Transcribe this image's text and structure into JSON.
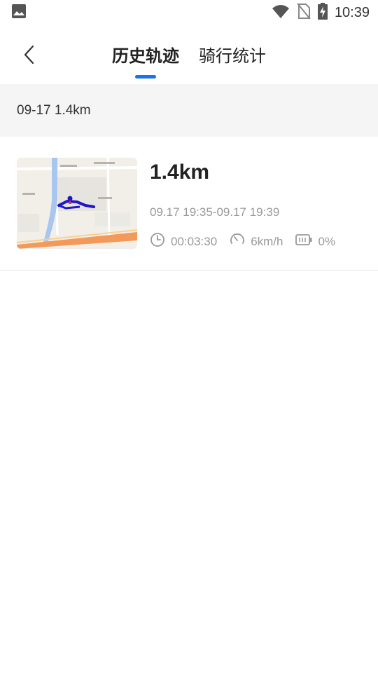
{
  "status_bar": {
    "time": "10:39",
    "icons": [
      "image-icon",
      "wifi-icon",
      "no-sim-icon",
      "battery-charging-icon"
    ]
  },
  "header": {
    "back_icon": "chevron-left-icon",
    "tabs": [
      {
        "label": "历史轨迹",
        "active": true
      },
      {
        "label": "骑行统计",
        "active": false
      }
    ],
    "accent_color": "#1a73e8"
  },
  "history": {
    "section_label": "09-17 1.4km",
    "rides": [
      {
        "distance": "1.4km",
        "time_range": "09.17 19:35-09.17 19:39",
        "duration": "00:03:30",
        "avg_speed": "6km/h",
        "battery": "0%"
      }
    ]
  }
}
